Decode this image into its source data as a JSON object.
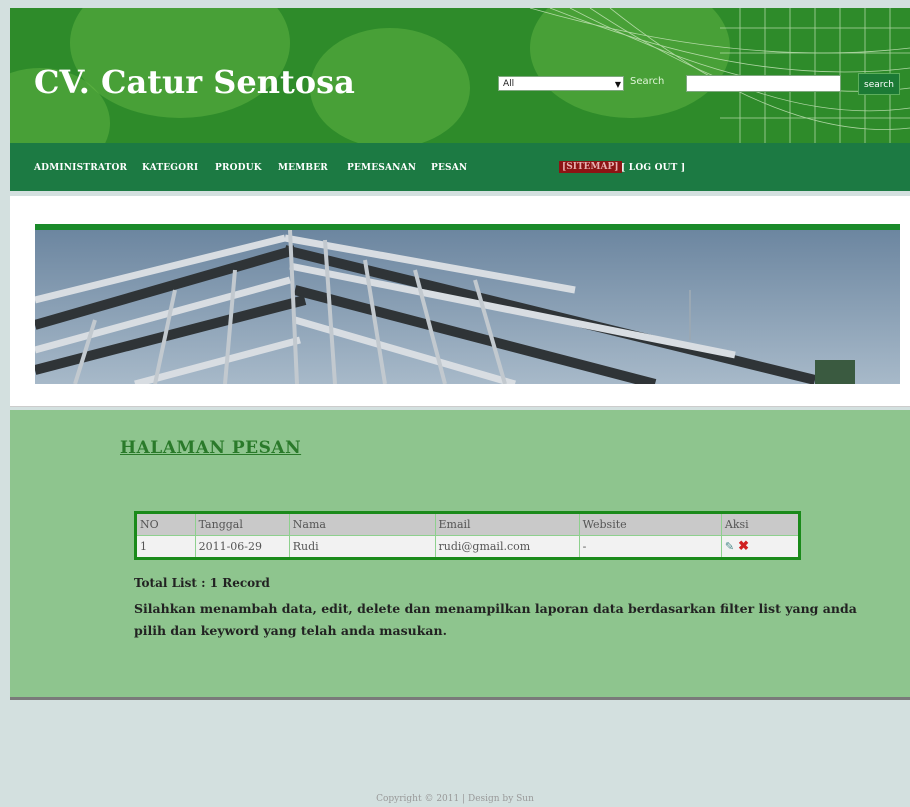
{
  "header": {
    "title": "CV. Catur Sentosa",
    "search_select_value": "All",
    "search_label": "Search",
    "search_input_value": "",
    "search_button_label": "search"
  },
  "nav": {
    "items": [
      "ADMINISTRATOR",
      "KATEGORI",
      "PRODUK",
      "MEMBER",
      "PEMESANAN",
      "PESAN"
    ],
    "highlight": "[SITEMAP]",
    "logout": "[ LOG OUT ]"
  },
  "content": {
    "heading": "HALAMAN PESAN",
    "table": {
      "headers": [
        "NO",
        "Tanggal",
        "Nama",
        "Email",
        "Website",
        "Aksi"
      ],
      "rows": [
        {
          "no": "1",
          "tanggal": "2011-06-29",
          "nama": "Rudi",
          "email": "rudi@gmail.com",
          "website": "-"
        }
      ]
    },
    "total": "Total List : 1 Record",
    "info": "Silahkan menambah data, edit, delete dan menampilkan laporan data berdasarkan filter list yang anda pilih dan keyword yang telah anda masukan."
  },
  "footer": {
    "text": "Copyright © 2011 | Design by Sun"
  },
  "colors": {
    "header_green": "#2e8b2a",
    "nav_green": "#1c7a43",
    "content_green": "#8ec58e",
    "heading_green": "#2a7a2a"
  }
}
